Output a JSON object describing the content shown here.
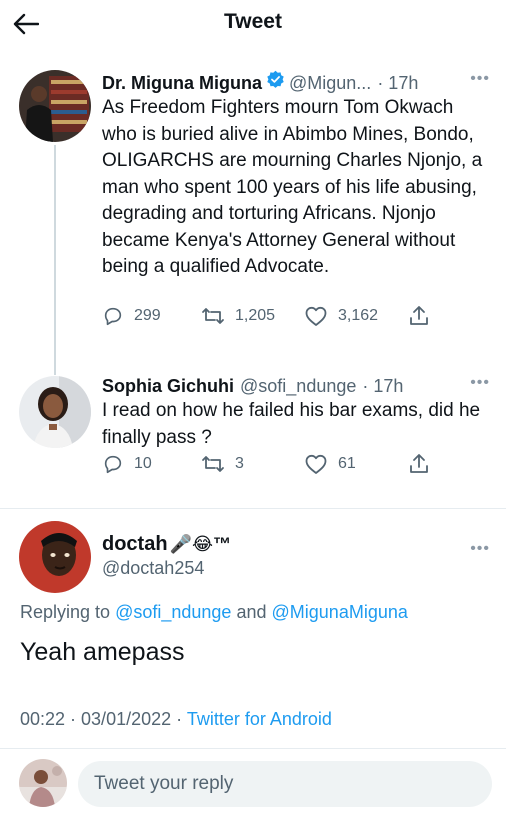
{
  "header": {
    "title": "Tweet"
  },
  "tweet1": {
    "name": "Dr. Miguna Miguna",
    "handle": "@Migun...",
    "time": "· 17h",
    "text": "As Freedom Fighters mourn Tom Okwach who is buried alive in Abimbo Mines, Bondo, OLIGARCHS are mourning Charles Njonjo, a man who spent 100 years of his life abusing, degrading and torturing Africans. Njonjo became Kenya's Attorney General without being a qualified Advocate.",
    "replies": "299",
    "retweets": "1,205",
    "likes": "3,162"
  },
  "tweet2": {
    "name": "Sophia Gichuhi",
    "handle": "@sofi_ndunge",
    "time": "· 17h",
    "text": "I read on how he failed his bar exams, did he finally pass ?",
    "replies": "10",
    "retweets": "3",
    "likes": "61"
  },
  "main": {
    "name": "doctah",
    "name_emoji": "🎤😂™",
    "handle": "@doctah254",
    "replying_prefix": "Replying to",
    "reply_to_1": "@sofi_ndunge",
    "reply_and": "and",
    "reply_to_2": "@MigunaMiguna",
    "text": "Yeah amepass",
    "datetime": "00:22 · 03/01/2022 ·",
    "client": "Twitter for Android"
  },
  "reply_bar": {
    "placeholder": "Tweet your reply"
  },
  "colors": {
    "accent": "#1d9bf0",
    "secondary_text": "#536471",
    "divider": "#e6ecf0"
  },
  "icons": [
    "back-arrow-icon",
    "verified-badge-icon",
    "more-icon",
    "reply-icon",
    "retweet-icon",
    "like-icon",
    "share-icon",
    "microphone-emoji"
  ]
}
